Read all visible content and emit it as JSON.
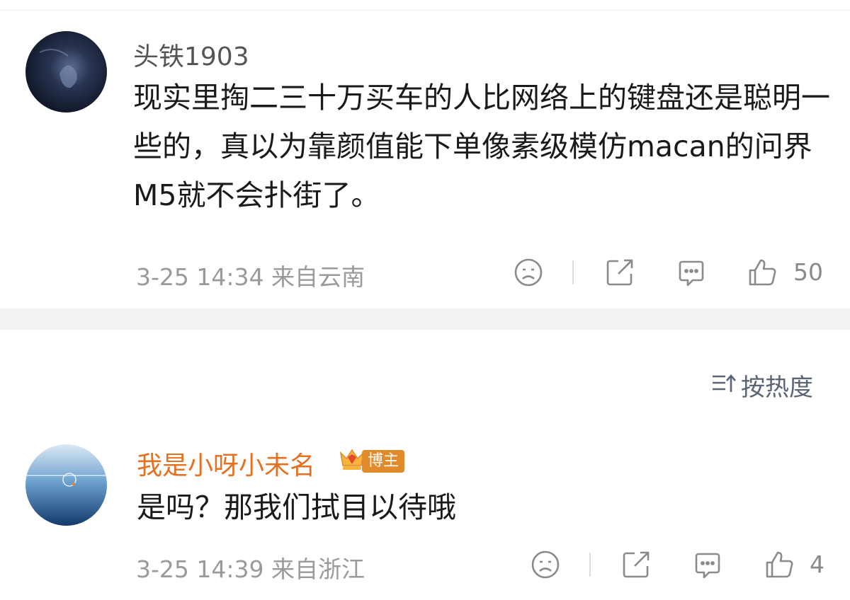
{
  "comments": [
    {
      "username": "头铁1903",
      "text": "现实里掏二三十万买车的人比网络上的键盘还是聪明一些的，真以为靠颜值能下单像素级模仿macan的问界M5就不会扑街了。",
      "meta": "3-25 14:34  来自云南",
      "likes": "50",
      "username_color": "#555555"
    },
    {
      "username": "我是小呀小未名",
      "badge": "博主",
      "text": "是吗？那我们拭目以待哦",
      "meta": "3-25 14:39  来自浙江",
      "likes": "4",
      "username_color": "#e57020"
    }
  ],
  "sort": {
    "label": "按热度",
    "icon": "sort-icon"
  },
  "icons": [
    "sad-face-icon",
    "share-icon",
    "comment-icon",
    "thumbs-up-icon"
  ]
}
